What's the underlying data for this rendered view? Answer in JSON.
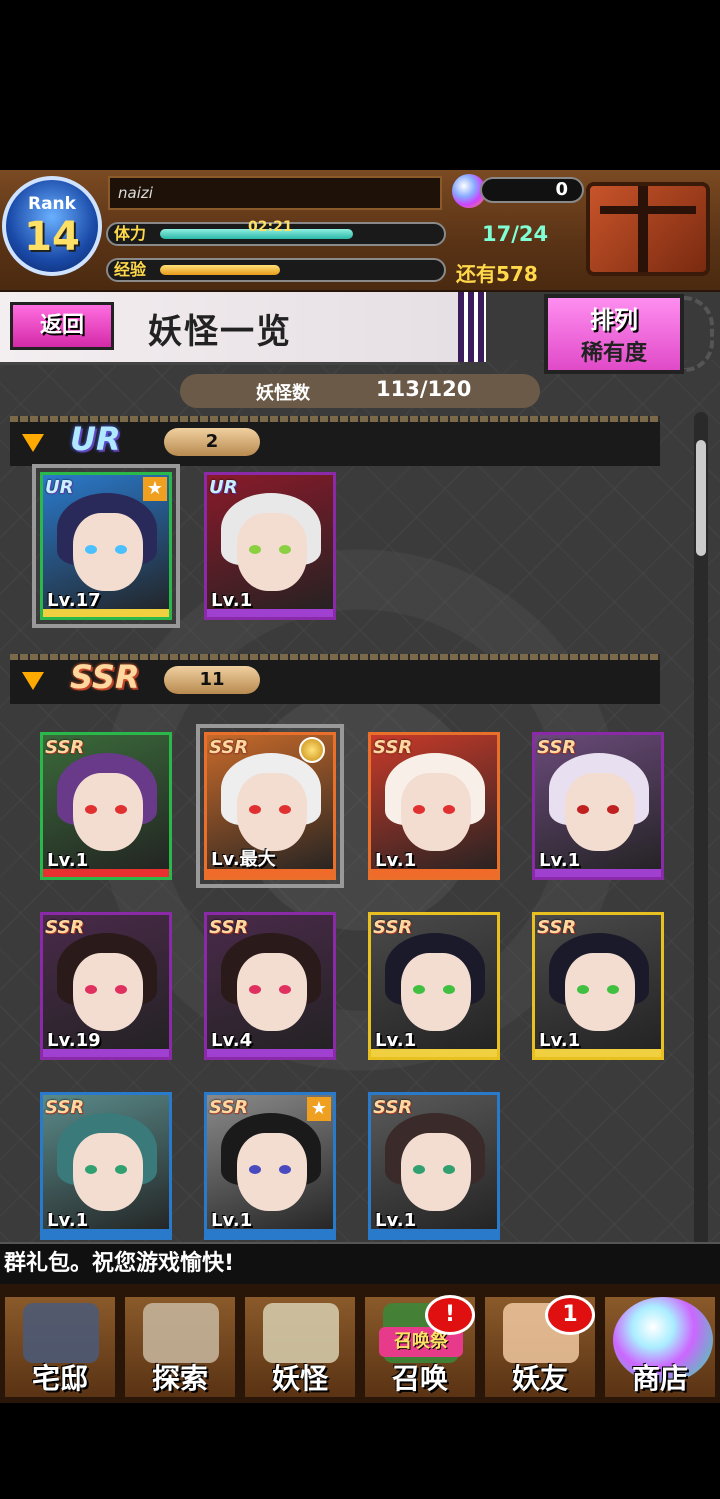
{
  "player": {
    "rank_label": "Rank",
    "rank": "14",
    "name": "naizi",
    "stamina_label": "体力",
    "stamina_timer": "02:21",
    "stamina_fraction": 0.69,
    "stamina_count": "17/24",
    "exp_label": "经验",
    "exp_fraction": 0.43,
    "exp_remaining": "还有578",
    "gems": "0"
  },
  "title_bar": {
    "back_label": "返回",
    "title": "妖怪一览",
    "sort_label": "排列",
    "sort_value": "稀有度"
  },
  "yokai_count": {
    "label": "妖怪数",
    "value": "113/120"
  },
  "sections": [
    {
      "rarity": "UR",
      "count": "2"
    },
    {
      "rarity": "SSR",
      "count": "11"
    }
  ],
  "ur_cards": [
    {
      "tag": "UR",
      "level": "Lv.17",
      "frame": "#2ab84a",
      "hair": "#2a2a5a",
      "eye": "#4ac0ff",
      "bg": "#2a7acc",
      "lvbar": "#f0d040"
    },
    {
      "tag": "UR",
      "level": "Lv.1",
      "frame": "#8a2aa8",
      "hair": "#e8e8e8",
      "eye": "#8ad040",
      "bg": "#8a1a2a",
      "lvbar": "#a040d0"
    }
  ],
  "ssr_cards": [
    {
      "tag": "SSR",
      "level": "Lv.1",
      "frame": "#2ab84a",
      "hair": "#6a3a8a",
      "eye": "#e03030",
      "bg": "#3a6a3a",
      "lvbar": "#e83030"
    },
    {
      "tag": "SSR",
      "level": "Lv.最大",
      "frame": "#e8702a",
      "hair": "#eeeeee",
      "eye": "#e03030",
      "bg": "#c86a2a",
      "lvbar": "#f06a2a"
    },
    {
      "tag": "SSR",
      "level": "Lv.1",
      "frame": "#e8702a",
      "hair": "#f8f0e8",
      "eye": "#e03030",
      "bg": "#c83a2a",
      "lvbar": "#f06a2a"
    },
    {
      "tag": "SSR",
      "level": "Lv.1",
      "frame": "#8a2aa8",
      "hair": "#e8dff0",
      "eye": "#c02020",
      "bg": "#6a4a7a",
      "lvbar": "#a040d0"
    },
    {
      "tag": "SSR",
      "level": "Lv.19",
      "frame": "#8a2aa8",
      "hair": "#2a1a1a",
      "eye": "#e03060",
      "bg": "#4a2a4a",
      "lvbar": "#a040d0"
    },
    {
      "tag": "SSR",
      "level": "Lv.4",
      "frame": "#8a2aa8",
      "hair": "#2a1a1a",
      "eye": "#e03060",
      "bg": "#4a2a4a",
      "lvbar": "#a040d0"
    },
    {
      "tag": "SSR",
      "level": "Lv.1",
      "frame": "#e8c020",
      "hair": "#1a1a2a",
      "eye": "#40c040",
      "bg": "#4a4a4a",
      "lvbar": "#f0d040"
    },
    {
      "tag": "SSR",
      "level": "Lv.1",
      "frame": "#e8c020",
      "hair": "#1a1a2a",
      "eye": "#40c040",
      "bg": "#4a4a4a",
      "lvbar": "#f0d040"
    },
    {
      "tag": "SSR",
      "level": "Lv.1",
      "frame": "#2a7acc",
      "hair": "#3a7a7a",
      "eye": "#30a070",
      "bg": "#5a8a8a",
      "lvbar": "#2a7acc"
    },
    {
      "tag": "SSR",
      "level": "Lv.1",
      "frame": "#2a7acc",
      "hair": "#1a1a1a",
      "eye": "#4a4ac0",
      "bg": "#8a8a8a",
      "lvbar": "#2a7acc"
    },
    {
      "tag": "SSR",
      "level": "Lv.1",
      "frame": "#2a7acc",
      "hair": "#3a2a2a",
      "eye": "#30a070",
      "bg": "#5a5a5a",
      "lvbar": "#2a7acc"
    }
  ],
  "ticker": "群礼包。祝您游戏愉快!",
  "nav": [
    {
      "label": "宅邸",
      "icon": "mansion-icon"
    },
    {
      "label": "探索",
      "icon": "magnifier-map-icon"
    },
    {
      "label": "妖怪",
      "icon": "scroll-icon"
    },
    {
      "label": "召唤",
      "icon": "summon-star-icon",
      "banner": "召唤祭",
      "badge": "!"
    },
    {
      "label": "妖友",
      "icon": "fox-girl-icon",
      "badge": "1"
    },
    {
      "label": "商店",
      "icon": "orb-icon"
    }
  ]
}
